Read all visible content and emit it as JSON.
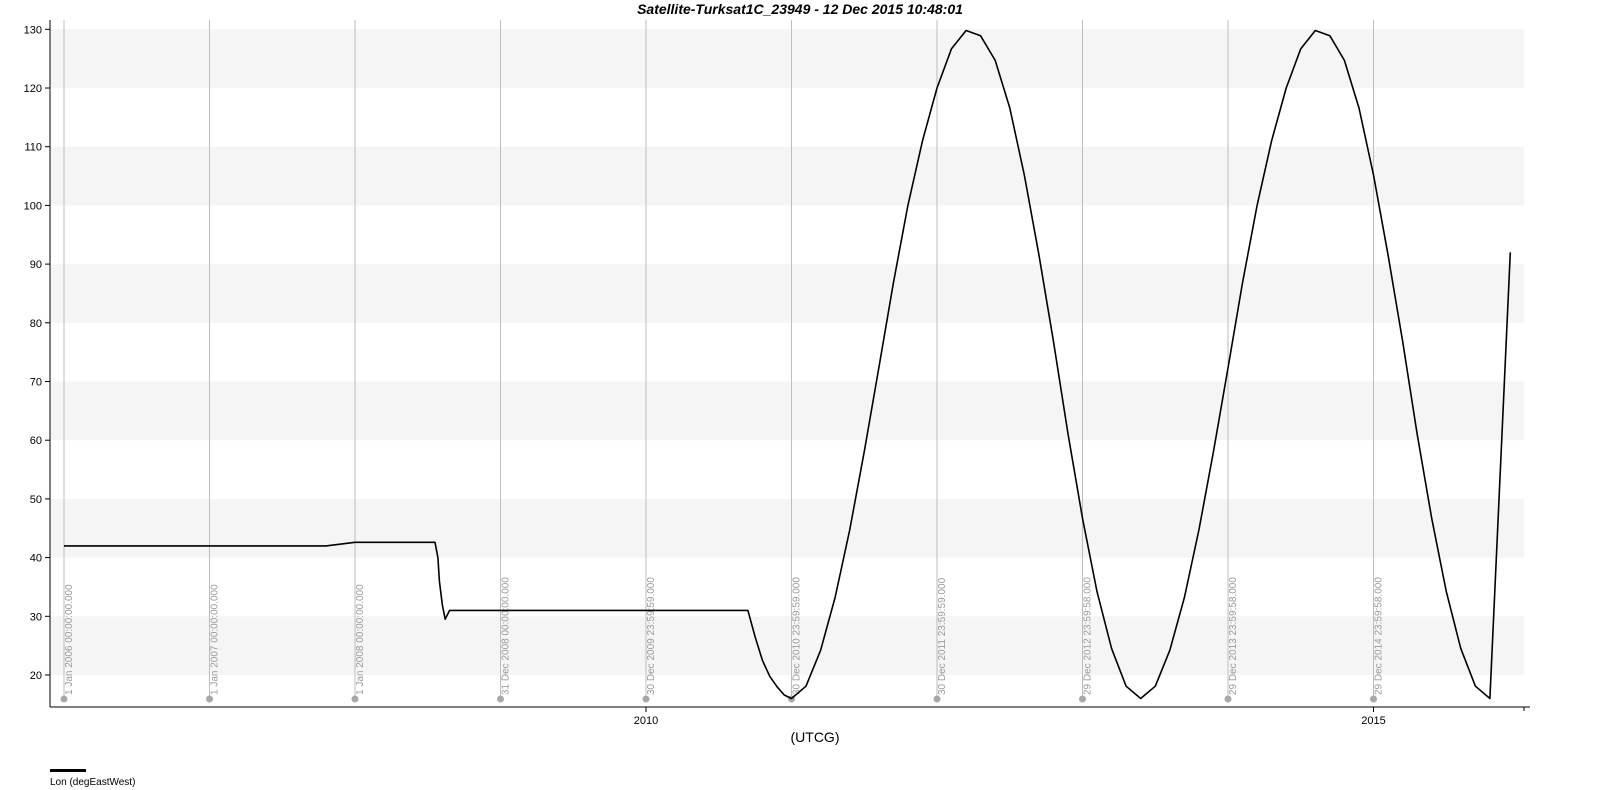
{
  "chart_data": {
    "type": "line",
    "title": "Satellite-Turksat1C_23949 - 12 Dec 2015 10:48:01",
    "xlabel": "(UTCG)",
    "ylabel": "",
    "x_unit": "year",
    "xlim": [
      2006.0,
      2016.1
    ],
    "ylim": [
      15,
      131
    ],
    "y_ticks": [
      20,
      30,
      40,
      50,
      60,
      70,
      80,
      90,
      100,
      110,
      120,
      130
    ],
    "x_ticks": [
      {
        "x": 2010.0,
        "label": "2010"
      },
      {
        "x": 2015.0,
        "label": "2015"
      }
    ],
    "markers": [
      {
        "x": 2006.0,
        "label": "1 Jan 2006 00:00:00.000"
      },
      {
        "x": 2007.0,
        "label": "1 Jan 2007 00:00:00.000"
      },
      {
        "x": 2008.0,
        "label": "1 Jan 2008 00:00:00.000"
      },
      {
        "x": 2009.0,
        "label": "31 Dec 2008 00:00:00.000"
      },
      {
        "x": 2010.0,
        "label": "30 Dec 2009 23:59:59.000"
      },
      {
        "x": 2011.0,
        "label": "30 Dec 2010 23:59:59.000"
      },
      {
        "x": 2012.0,
        "label": "30 Dec 2011 23:59:59.000"
      },
      {
        "x": 2013.0,
        "label": "29 Dec 2012 23:59:58.000"
      },
      {
        "x": 2014.0,
        "label": "29 Dec 2013 23:59:58.000"
      },
      {
        "x": 2015.0,
        "label": "29 Dec 2014 23:59:58.000"
      }
    ],
    "grid": true,
    "legend_position": "bottom-left",
    "series": [
      {
        "name": "Lon (degEastWest)",
        "color": "#000000",
        "x": [
          2006.0,
          2007.0,
          2007.8,
          2008.0,
          2008.55,
          2008.57,
          2008.58,
          2008.6,
          2008.62,
          2008.65,
          2008.7,
          2009.0,
          2010.0,
          2010.7,
          2010.75,
          2010.8,
          2010.85,
          2010.9,
          2010.95,
          2011.0,
          2011.1,
          2011.2,
          2011.3,
          2011.4,
          2011.5,
          2011.6,
          2011.7,
          2011.8,
          2011.9,
          2012.0,
          2012.1,
          2012.2,
          2012.3,
          2012.4,
          2012.5,
          2012.6,
          2012.7,
          2012.8,
          2012.9,
          2013.0,
          2013.1,
          2013.2,
          2013.3,
          2013.4,
          2013.5,
          2013.6,
          2013.7,
          2013.8,
          2013.9,
          2014.0,
          2014.1,
          2014.2,
          2014.3,
          2014.4,
          2014.5,
          2014.6,
          2014.7,
          2014.8,
          2014.9,
          2015.0,
          2015.1,
          2015.2,
          2015.3,
          2015.4,
          2015.5,
          2015.6,
          2015.7,
          2015.8,
          2015.94
        ],
        "values": [
          42.0,
          42.0,
          42.0,
          42.6,
          42.6,
          40.0,
          36.0,
          32.0,
          29.5,
          31.0,
          31.0,
          31.0,
          31.0,
          31.0,
          26.5,
          22.5,
          19.8,
          18.0,
          16.6,
          16.0,
          18.1,
          24.2,
          33.2,
          44.7,
          58.1,
          72.3,
          86.8,
          100.0,
          111.0,
          120.0,
          126.7,
          129.8,
          128.9,
          124.7,
          116.6,
          105.2,
          91.6,
          76.9,
          61.1,
          46.7,
          34.2,
          24.5,
          18.1,
          16.0,
          18.1,
          24.2,
          33.2,
          44.7,
          58.1,
          72.3,
          86.8,
          100.0,
          111.0,
          120.0,
          126.7,
          129.8,
          128.9,
          124.7,
          116.6,
          105.2,
          91.6,
          76.9,
          61.1,
          46.7,
          34.2,
          24.5,
          18.1,
          16.0,
          92.0
        ]
      }
    ]
  }
}
